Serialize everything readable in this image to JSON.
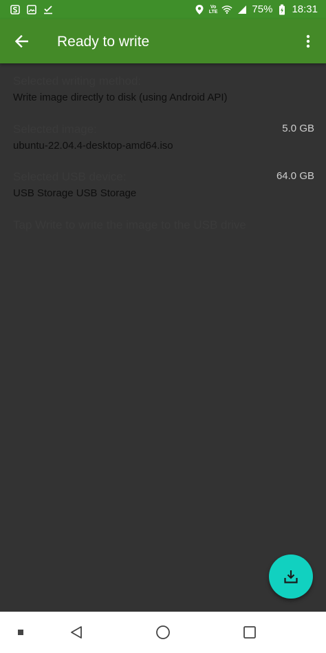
{
  "status_bar": {
    "icons_left": [
      "app-s-icon",
      "image-icon",
      "checkmark-icon"
    ],
    "network_label": "Vo\nLTE",
    "battery_percent": "75%",
    "time": "18:31"
  },
  "app_bar": {
    "title": "Ready to write",
    "back_icon": "arrow-back-icon",
    "menu_icon": "more-vert-icon"
  },
  "sections": {
    "method": {
      "label": "Selected writing method:",
      "value": "Write image directly to disk (using Android API)"
    },
    "image": {
      "label": "Selected image:",
      "value": "ubuntu-22.04.4-desktop-amd64.iso",
      "size": "5.0 GB"
    },
    "usb": {
      "label": "Selected USB device:",
      "value": "USB Storage USB Storage",
      "size": "64.0 GB"
    },
    "hint": "Tap Write to write the image to the USB drive"
  },
  "fab": {
    "icon": "download-icon"
  },
  "nav_bar": {
    "items": [
      "recents-dot-icon",
      "back-triangle-icon",
      "home-circle-icon",
      "overview-square-icon"
    ]
  },
  "colors": {
    "status_bar": "#3f8f2a",
    "app_bar": "#448a28",
    "background": "#333333",
    "fab": "#11d1c0"
  }
}
